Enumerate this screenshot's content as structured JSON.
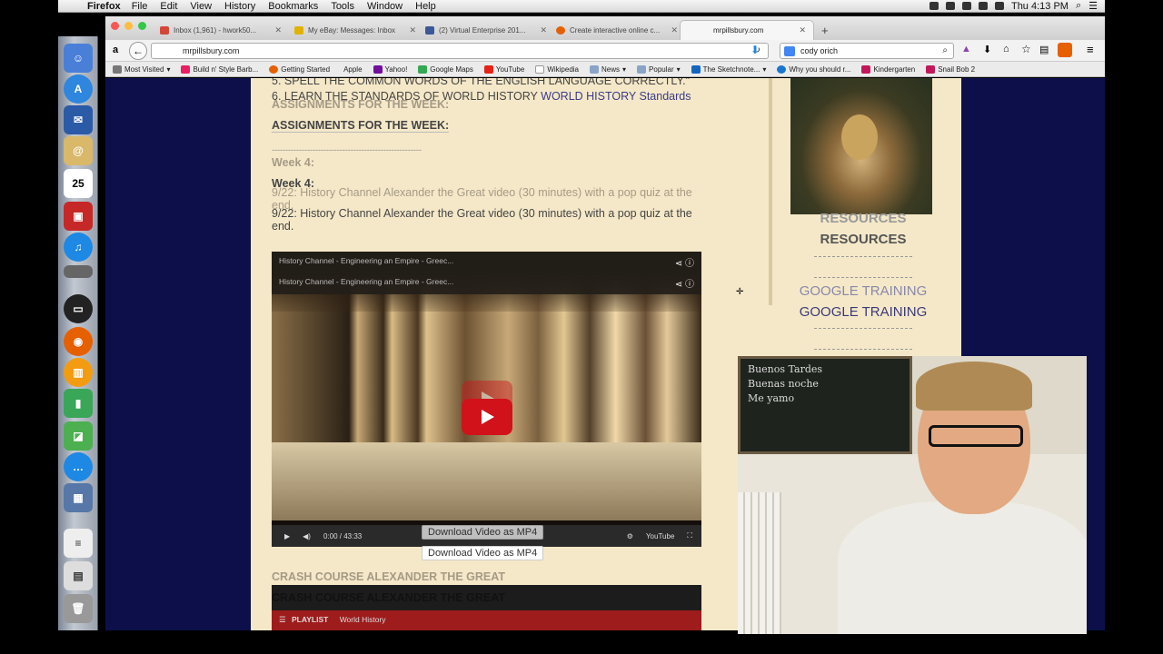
{
  "menubar": {
    "app": "Firefox",
    "items": [
      "File",
      "Edit",
      "View",
      "History",
      "Bookmarks",
      "Tools",
      "Window",
      "Help"
    ],
    "clock": "Thu 4:13 PM"
  },
  "tabs": [
    {
      "label": "Inbox (1,961) - hwork50...",
      "color": "#d44638"
    },
    {
      "label": "My eBay: Messages: Inbox",
      "color": "#e0b300"
    },
    {
      "label": "(2) Virtual Enterprise 201...",
      "color": "#3b5998"
    },
    {
      "label": "Create interactive online c...",
      "color": "#e66000"
    },
    {
      "label": "mrpillsbury.com",
      "color": "#999999"
    }
  ],
  "nav": {
    "url": "mrpillsbury.com",
    "search_value": "cody orich"
  },
  "bookmarks": [
    "Most Visited",
    "Build n' Style Barb...",
    "Getting Started",
    "Apple",
    "Yahoo!",
    "Google Maps",
    "YouTube",
    "Wikipedia",
    "News",
    "Popular",
    "The Sketchnote...",
    "Why you should r...",
    "Kindergarten",
    "Snail Bob 2"
  ],
  "article": {
    "line5": "5. SPELL THE COMMON WORDS OF THE ENGLISH LANGUAGE CORRECTLY.\"",
    "line6": "6. LEARN THE STANDARDS OF WORLD HISTORY",
    "line6_link": "WORLD HISTORY Standards",
    "assign_heading": "ASSIGNMENTS FOR THE WEEK:",
    "dashes": "-------------------------------------------------------",
    "week": "Week 4:",
    "item_line1": "9/22: History Channel Alexander the Great video (30 minutes) with a pop quiz at the",
    "item_line2": "end.",
    "crash_heading": "CRASH COURSE ALEXANDER THE GREAT"
  },
  "video": {
    "title": "History Channel - Engineering an Empire - Greec...",
    "time": "0:00 / 43:33",
    "download_label": "Download Video as MP4",
    "yt_label": "YouTube"
  },
  "playlist": {
    "label": "PLAYLIST",
    "name": "World History"
  },
  "sidebar": {
    "resources": "RESOURCES",
    "dashes": "-------------------",
    "google_training": "GOOGLE TRAINING"
  },
  "webcam": {
    "board_lines": [
      "Buenos Tardes",
      "Buenas noche",
      "Me yamo"
    ]
  }
}
